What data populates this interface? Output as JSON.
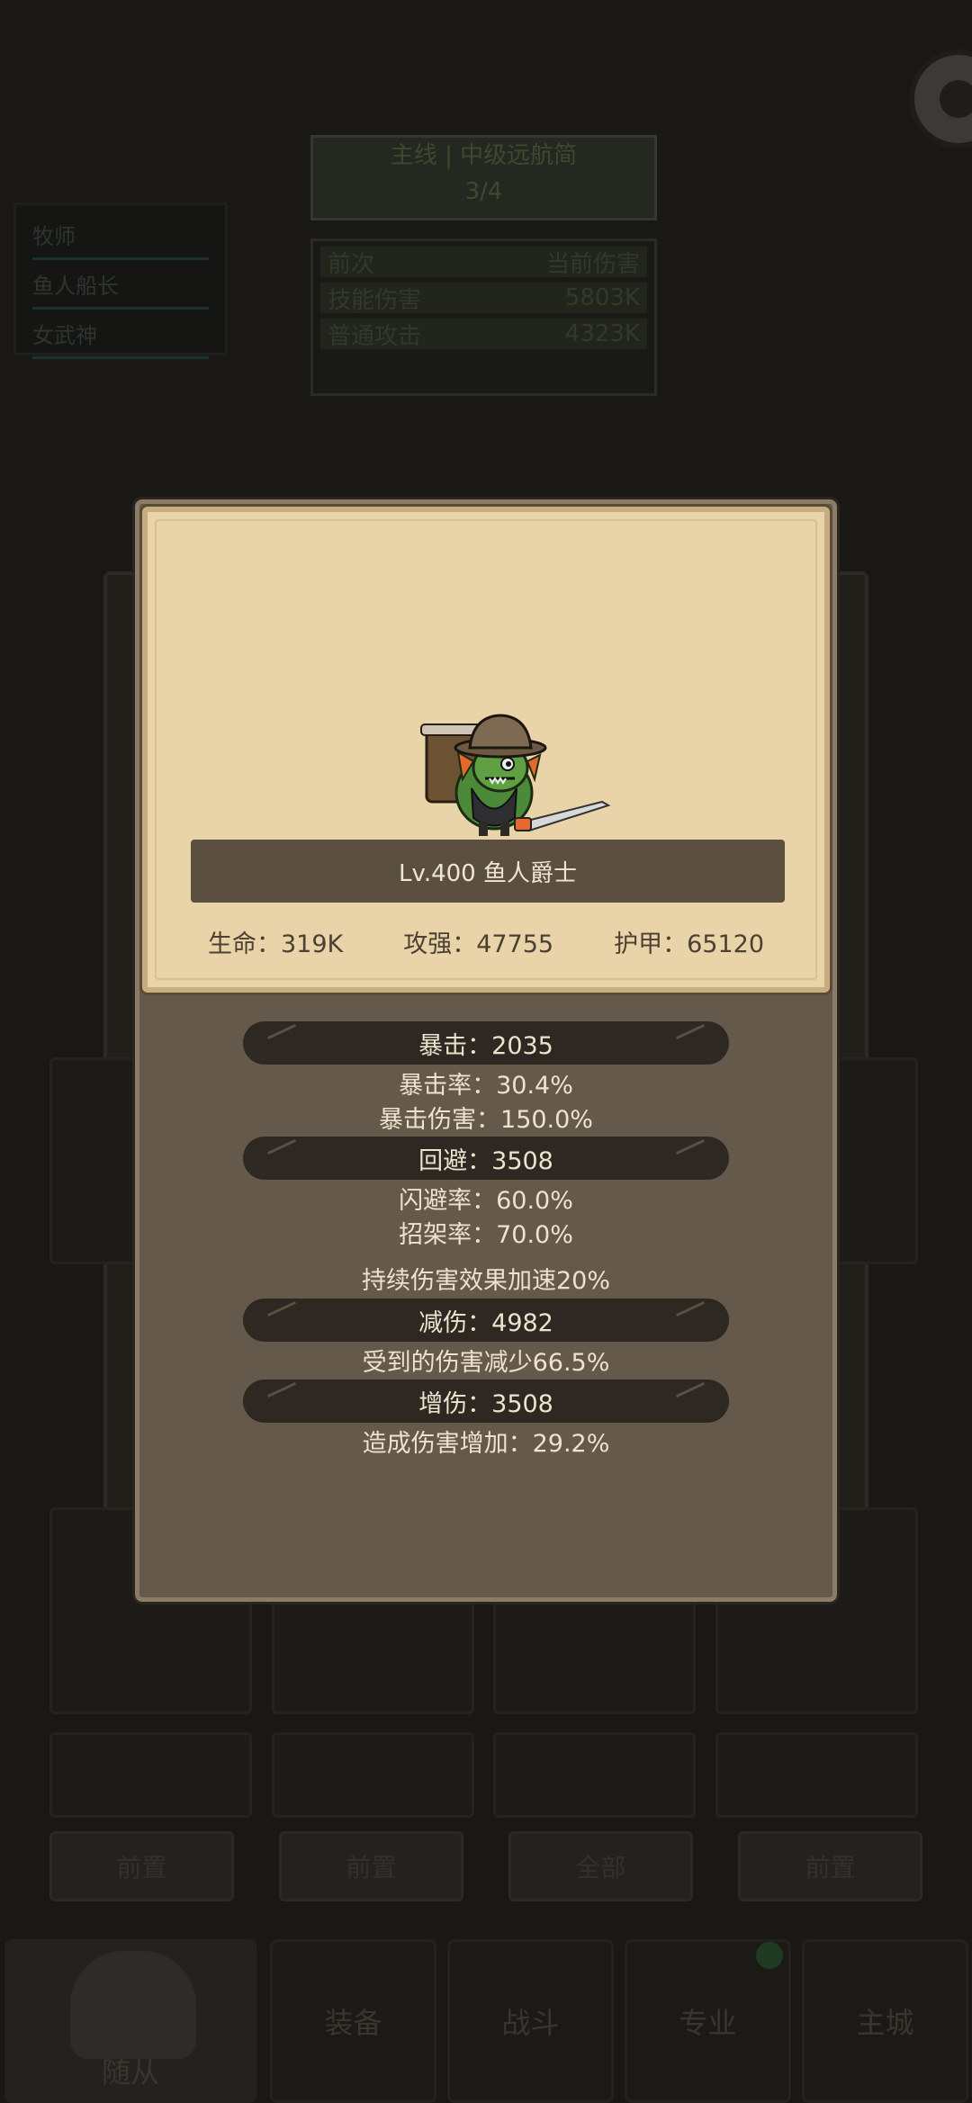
{
  "background": {
    "quest_title": "主线 | 中级远航简",
    "quest_progress": "3/4",
    "ranking_rows": [
      {
        "name": "前次",
        "value": "当前伤害"
      },
      {
        "name": "技能伤害",
        "value": "5803K"
      },
      {
        "name": "普通攻击",
        "value": "4323K"
      }
    ],
    "party_list": [
      "牧师",
      "鱼人船长",
      "女武神"
    ],
    "bottom_buttons": [
      "前置",
      "前置",
      "全部",
      "前置"
    ],
    "tabs": [
      "随从",
      "装备",
      "战斗",
      "专业",
      "主城"
    ]
  },
  "unit": {
    "name_line": "Lv.400 鱼人爵士",
    "hp": "生命：319K",
    "attack": "攻强：47755",
    "armor": "护甲：65120"
  },
  "stats": {
    "crit": "暴击：2035",
    "crit_rate": "暴击率：30.4%",
    "crit_damage": "暴击伤害：150.0%",
    "dodge": "回避：3508",
    "dodge_rate": "闪避率：60.0%",
    "parry_rate": "招架率：70.0%",
    "dot_speed": "持续伤害效果加速20%",
    "damage_reduction": "减伤：4982",
    "damage_taken": "受到的伤害减少66.5%",
    "damage_boost": "增伤：3508",
    "damage_dealt": "造成伤害增加：29.2%"
  },
  "colors": {
    "modal_bg": "#64594a",
    "card_bg": "#e8d4a8",
    "banner_bg": "#5b4f3f",
    "pill_bg": "#2d2821"
  }
}
